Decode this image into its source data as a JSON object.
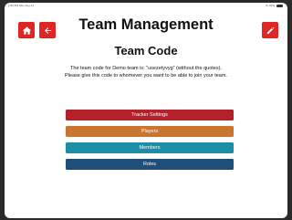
{
  "status_bar": {
    "time": "1:50 PM  Mon Aug 21",
    "signal": "⁂ 64%"
  },
  "header": {
    "title": "Team Management",
    "subtitle": "Team Code",
    "icons": {
      "home": "home-icon",
      "back": "back-arrow-icon",
      "edit": "pencil-icon"
    }
  },
  "body": {
    "line1": "The team code for Demo team is: \"usezetyvyg\" (without the quotes).",
    "line2": "Please give this code to whomever you want to be able to join your team."
  },
  "menu": {
    "tracker_settings": "Tracker Settings",
    "players": "Players",
    "members": "Members",
    "roles": "Roles"
  },
  "colors": {
    "header_button": "#e02525",
    "tracker_settings": "#b3212b",
    "players": "#c9752f",
    "members": "#1d8ea6",
    "roles": "#1f4e7a"
  }
}
